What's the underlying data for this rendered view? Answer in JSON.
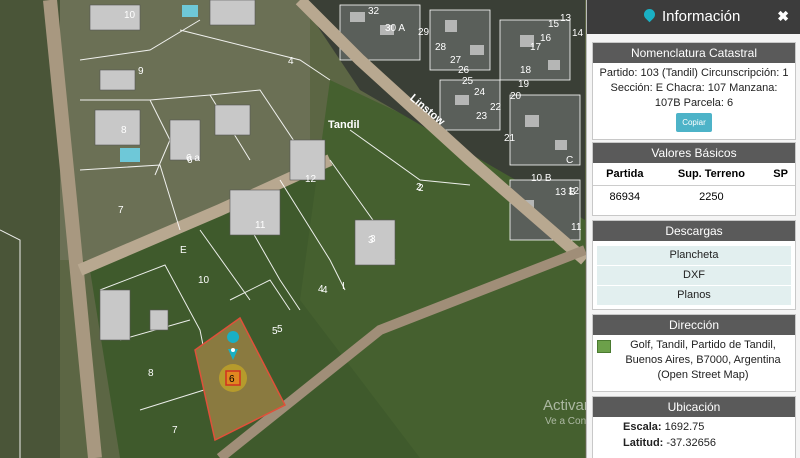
{
  "map": {
    "street_label": "Linstow",
    "place_label": "Tandil",
    "sector_labels": [
      "E",
      "I"
    ],
    "lot_labels_west": [
      "10",
      "9",
      "8",
      "7",
      "6",
      "5",
      "4",
      "3",
      "2"
    ],
    "lot_labels_central": [
      "4",
      "6 a",
      "12",
      "11",
      "3",
      "2",
      "10",
      "4",
      "5",
      "8",
      "7"
    ],
    "lot_labels_east": [
      "32",
      "30 A",
      "29",
      "28",
      "27",
      "26",
      "25",
      "24",
      "23",
      "22",
      "21",
      "20",
      "19",
      "18",
      "17",
      "16",
      "15",
      "14",
      "13",
      "12",
      "11",
      "10 B",
      "13 B",
      "C"
    ],
    "selected_lot": "6",
    "watermark_line1": "Activar Windows",
    "watermark_line2": "Ve a Configuración para activar Windows."
  },
  "panel": {
    "title": "Información",
    "close_symbol": "✖",
    "nomenclatura": {
      "header": "Nomenclatura Catastral",
      "text": "Partido: 103 (Tandil) Circunscripción: 1 Sección: E Chacra: 107 Manzana: 107B Parcela: 6",
      "copy_button": "Copiar"
    },
    "valores": {
      "header": "Valores Básicos",
      "columns": [
        "Partida",
        "Sup. Terreno",
        "SP"
      ],
      "row": [
        "86934",
        "2250",
        ""
      ]
    },
    "descargas": {
      "header": "Descargas",
      "items": [
        "Plancheta",
        "DXF",
        "Planos"
      ]
    },
    "direccion": {
      "header": "Dirección",
      "text": "Golf, Tandil, Partido de Tandil, Buenos Aires, B7000, Argentina (Open Street Map)"
    },
    "ubicacion": {
      "header": "Ubicación",
      "escala_label": "Escala:",
      "escala_value": "1692.75",
      "latitud_label": "Latitud:",
      "latitud_value": "-37.32656"
    }
  }
}
